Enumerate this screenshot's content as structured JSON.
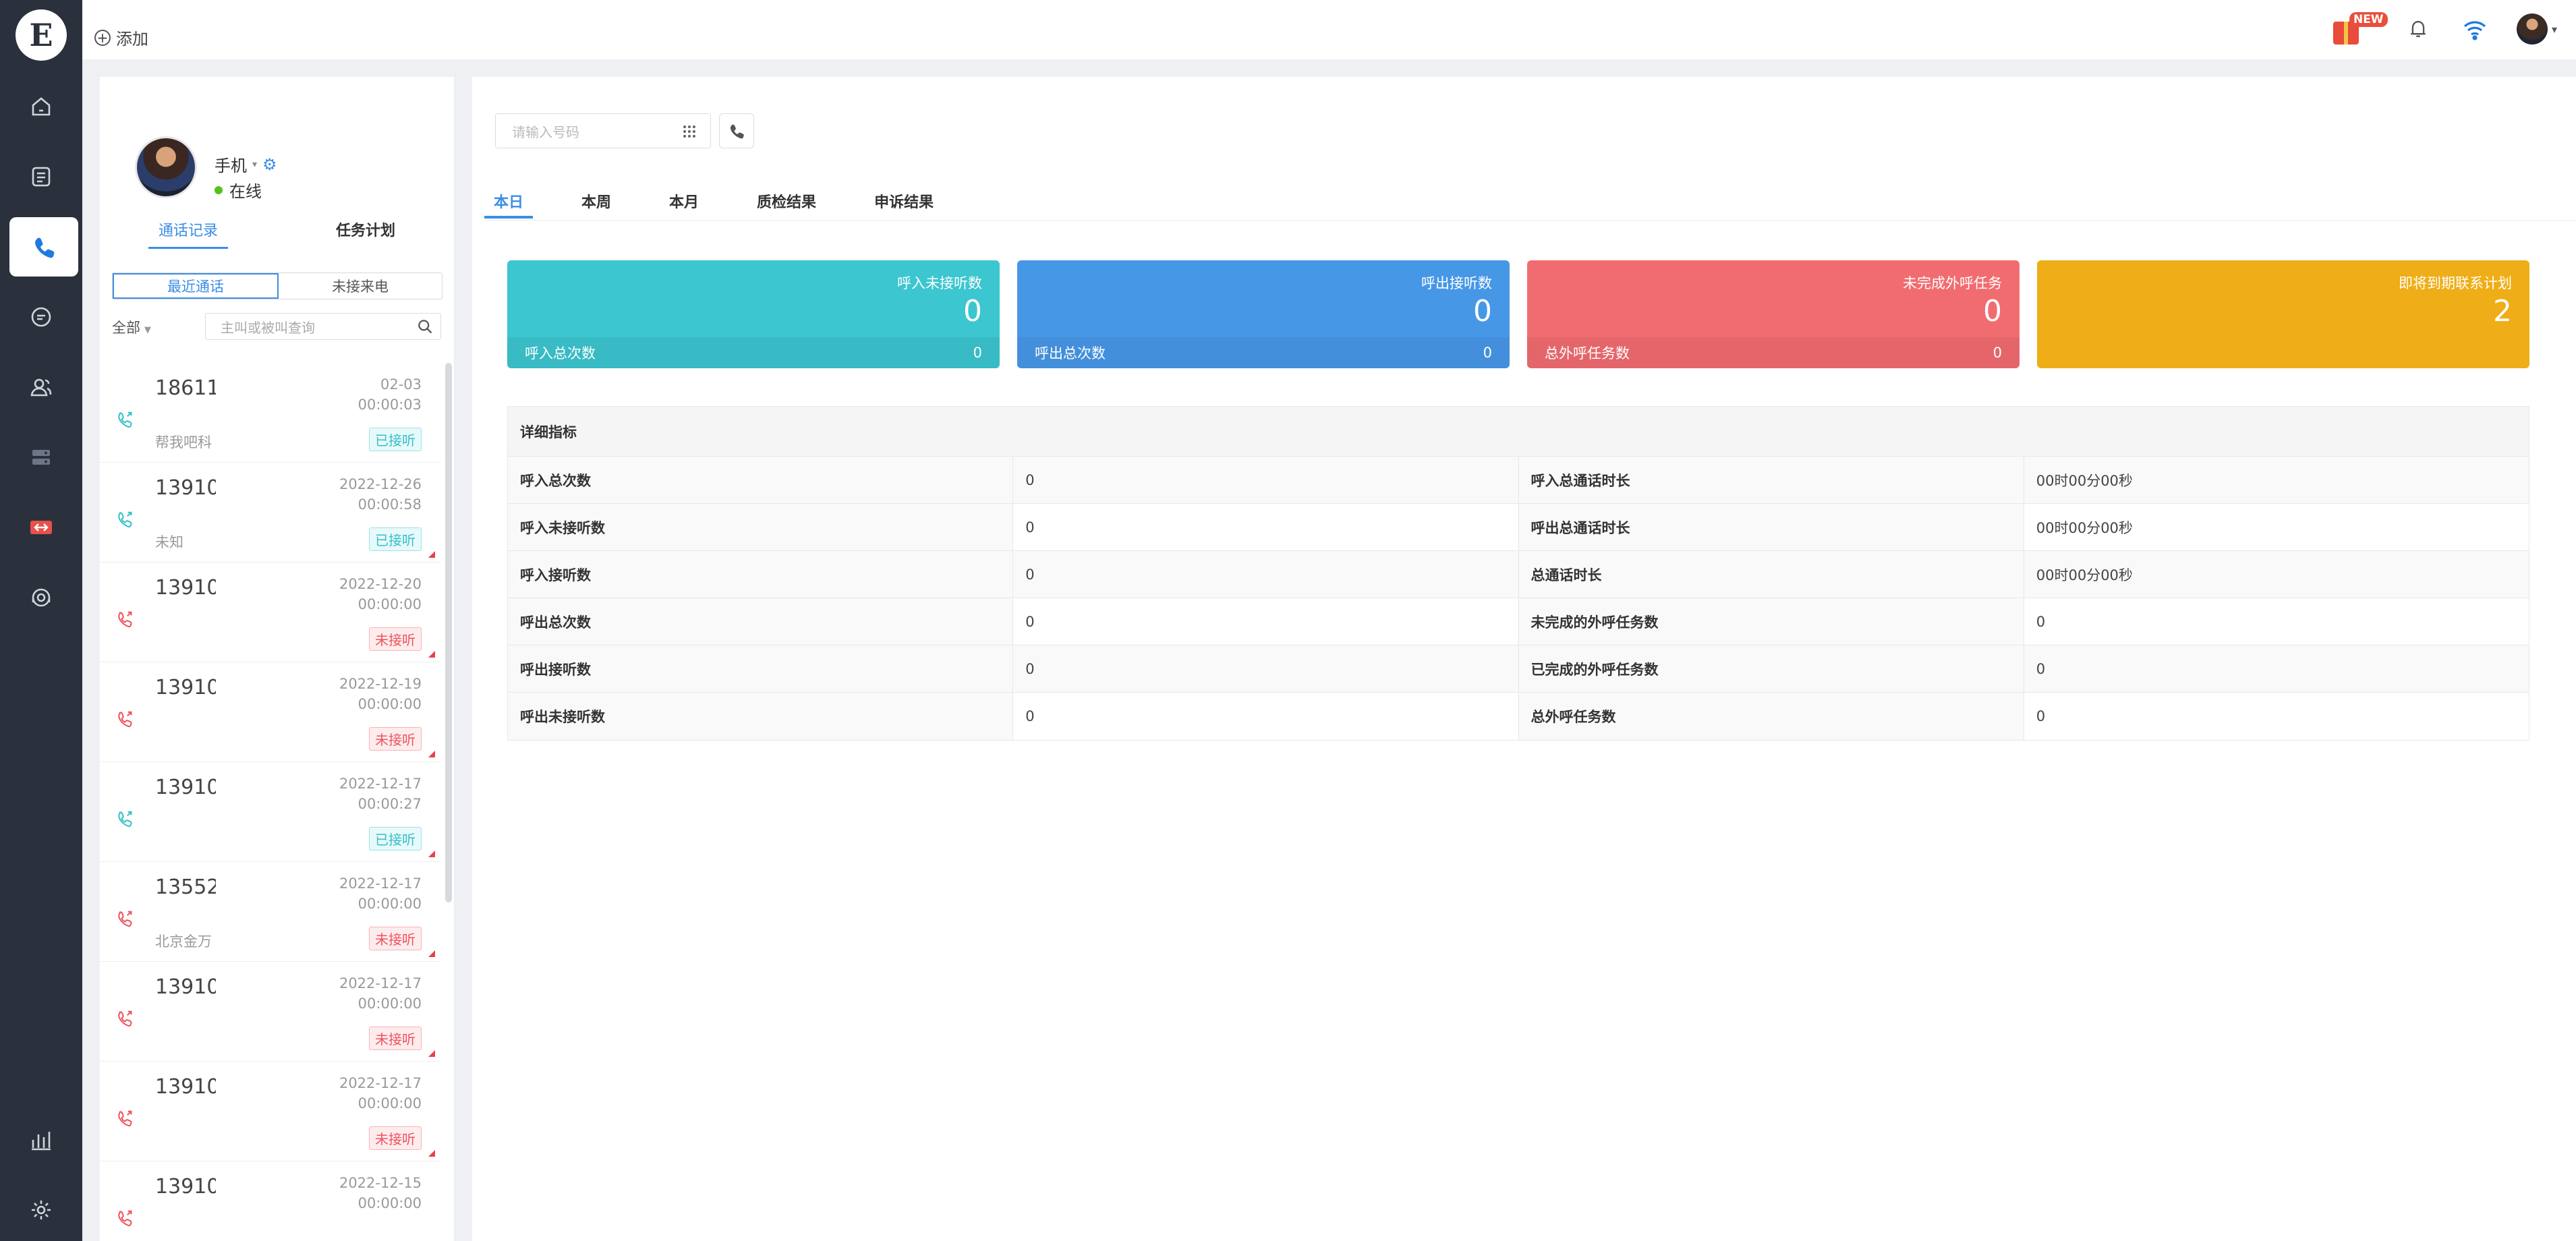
{
  "brand": {
    "logo_glyph": "E",
    "accent_color": "#3b8ee6"
  },
  "topbar": {
    "add_label": "添加",
    "new_badge": "NEW"
  },
  "nav": {
    "items": [
      "home-icon",
      "document-icon",
      "phone-icon",
      "chat-icon",
      "contacts-icon",
      "server-icon",
      "link-icon",
      "support-icon",
      "chart-icon",
      "settings-icon"
    ],
    "active": "phone-icon"
  },
  "agent": {
    "device": "手机",
    "status": "在线",
    "status_color": "#52c41a"
  },
  "left_tabs": {
    "call_log": "通话记录",
    "task_plan": "任务计划"
  },
  "segments": {
    "recent": "最近通话",
    "missed": "未接来电"
  },
  "filter": {
    "all": "全部",
    "search_placeholder": "主叫或被叫查询"
  },
  "calls": [
    {
      "number": "18611(",
      "sub": "帮我吧科",
      "date": "02-03",
      "duration": "00:00:03",
      "status": "已接听",
      "type": "ok"
    },
    {
      "number": "13910",
      "sub": "未知",
      "date": "2022-12-26",
      "duration": "00:00:58",
      "status": "已接听",
      "type": "ok"
    },
    {
      "number": "13910",
      "sub": "",
      "date": "2022-12-20",
      "duration": "00:00:00",
      "status": "未接听",
      "type": "no"
    },
    {
      "number": "13910",
      "sub": "",
      "date": "2022-12-19",
      "duration": "00:00:00",
      "status": "未接听",
      "type": "no"
    },
    {
      "number": "13910",
      "sub": "",
      "date": "2022-12-17",
      "duration": "00:00:27",
      "status": "已接听",
      "type": "ok"
    },
    {
      "number": "13552(",
      "sub": "北京金万",
      "date": "2022-12-17",
      "duration": "00:00:00",
      "status": "未接听",
      "type": "no"
    },
    {
      "number": "13910",
      "sub": "",
      "date": "2022-12-17",
      "duration": "00:00:00",
      "status": "未接听",
      "type": "no"
    },
    {
      "number": "13910",
      "sub": "",
      "date": "2022-12-17",
      "duration": "00:00:00",
      "status": "未接听",
      "type": "no"
    },
    {
      "number": "13910",
      "sub": "",
      "date": "2022-12-15",
      "duration": "00:00:00",
      "status": "",
      "type": "no"
    }
  ],
  "dial": {
    "placeholder": "请输入号码"
  },
  "main_tabs": [
    "本日",
    "本周",
    "本月",
    "质检结果",
    "申诉结果"
  ],
  "kpis": [
    {
      "label": "呼入未接听数",
      "value": "0",
      "foot_label": "呼入总次数",
      "foot_value": "0",
      "color": "#3cc6cf"
    },
    {
      "label": "呼出接听数",
      "value": "0",
      "foot_label": "呼出总次数",
      "foot_value": "0",
      "color": "#4797e7"
    },
    {
      "label": "未完成外呼任务",
      "value": "0",
      "foot_label": "总外呼任务数",
      "foot_value": "0",
      "color": "#f16c70"
    },
    {
      "label": "即将到期联系计划",
      "value": "2",
      "foot_label": "",
      "foot_value": "",
      "color": "#efae17"
    }
  ],
  "detail": {
    "title": "详细指标",
    "rows": [
      [
        "呼入总次数",
        "0",
        "呼入总通话时长",
        "00时00分00秒"
      ],
      [
        "呼入未接听数",
        "0",
        "呼出总通话时长",
        "00时00分00秒"
      ],
      [
        "呼入接听数",
        "0",
        "总通话时长",
        "00时00分00秒"
      ],
      [
        "呼出总次数",
        "0",
        "未完成的外呼任务数",
        "0"
      ],
      [
        "呼出接听数",
        "0",
        "已完成的外呼任务数",
        "0"
      ],
      [
        "呼出未接听数",
        "0",
        "总外呼任务数",
        "0"
      ]
    ]
  }
}
